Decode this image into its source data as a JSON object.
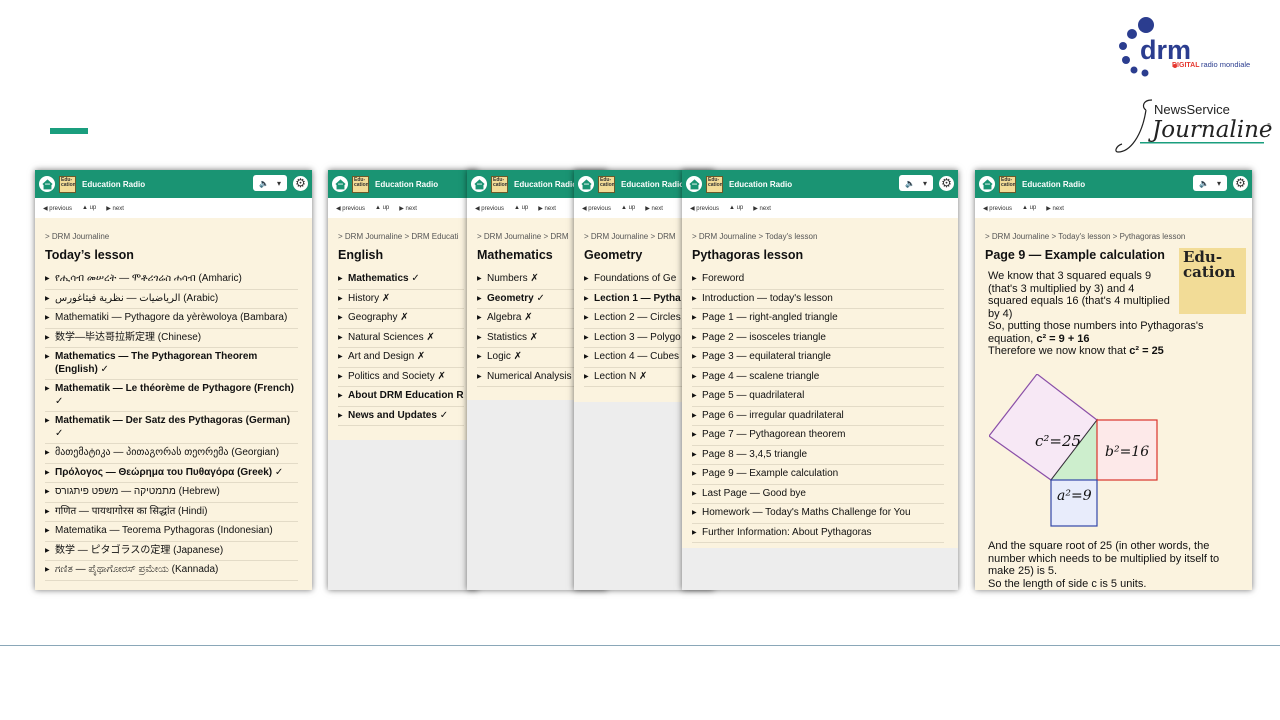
{
  "branding": {
    "drm_logo_text": "drm",
    "drm_sub_digital": "DIGITAL",
    "drm_sub_rest": "radio mondiale",
    "jl_news": "NewsService",
    "jl_name": "Journaline",
    "jl_mark": "®"
  },
  "colors": {
    "header_green": "#1a9473",
    "accent": "#1a9e7e",
    "background": "#fbf3df"
  },
  "app": {
    "title": "Education Radio",
    "nav_prev": "previous",
    "nav_up": "up",
    "nav_next": "next",
    "thumb_text": "Edu-cation"
  },
  "panels": [
    {
      "id": "p1",
      "crumb": "> DRM Journaline",
      "title": "Today’s lesson",
      "items": [
        {
          "t": "የሒሳብ መሠረት — ሞቶሪጎሬስ ሐሳብ (Amharic)",
          "b": false
        },
        {
          "t": "الرياضيات — نظرية فيثاغورس (Arabic)",
          "b": false
        },
        {
          "t": "Mathematiki — Pythagore da yèrèwoloya (Bambara)",
          "b": false
        },
        {
          "t": "数学—毕达哥拉斯定理 (Chinese)",
          "b": false
        },
        {
          "t": "Mathematics — The Pythagorean Theorem (English) ✓",
          "b": true
        },
        {
          "t": "Mathematik — Le théorème de Pythagore (French) ✓",
          "b": true
        },
        {
          "t": "Mathematik — Der Satz des Pythagoras (German) ✓",
          "b": true
        },
        {
          "t": "მათემატიკა — პითაგორას თეორემა (Georgian)",
          "b": false
        },
        {
          "t": "Πρόλογος — Θεώρημα του Πυθαγόρα (Greek) ✓",
          "b": true
        },
        {
          "t": "מתמטיקה — משפט פיתגורס (Hebrew)",
          "b": false
        },
        {
          "t": "गणित — पायथागोरस का सिद्धांत (Hindi)",
          "b": false
        },
        {
          "t": "Matematika — Teorema Pythagoras (Indonesian)",
          "b": false
        },
        {
          "t": "数学 — ピタゴラスの定理 (Japanese)",
          "b": false
        },
        {
          "t": "ಗಣಿತ — ಪೈಥಾಗೋರಸ್ ಪ್ರಮೇಯ (Kannada)",
          "b": false
        }
      ]
    },
    {
      "id": "p2",
      "crumb": "> DRM Journaline  > DRM Educati",
      "title": "English",
      "items": [
        {
          "t": "Mathematics ✓",
          "b": true
        },
        {
          "t": "History ✗",
          "b": false
        },
        {
          "t": "Geography ✗",
          "b": false
        },
        {
          "t": "Natural Sciences ✗",
          "b": false
        },
        {
          "t": "Art and Design ✗",
          "b": false
        },
        {
          "t": "Politics and Society ✗",
          "b": false
        },
        {
          "t": "About DRM Education R",
          "b": true
        },
        {
          "t": "News and Updates ✓",
          "b": true
        }
      ]
    },
    {
      "id": "p3",
      "crumb": "> DRM Journaline  > DRM",
      "title": "Mathematics",
      "items": [
        {
          "t": "Numbers ✗",
          "b": false
        },
        {
          "t": "Geometry ✓",
          "b": true
        },
        {
          "t": "Algebra ✗",
          "b": false
        },
        {
          "t": "Statistics ✗",
          "b": false
        },
        {
          "t": "Logic ✗",
          "b": false
        },
        {
          "t": "Numerical Analysis",
          "b": false
        }
      ]
    },
    {
      "id": "p4",
      "crumb": "> DRM Journaline  > DRM",
      "title": "Geometry",
      "items": [
        {
          "t": "Foundations of Ge",
          "b": false
        },
        {
          "t": "Lection 1 — Pytha",
          "b": true
        },
        {
          "t": "Lection 2 — Circles",
          "b": false
        },
        {
          "t": "Lection 3 — Polygo",
          "b": false
        },
        {
          "t": "Lection 4 — Cubes",
          "b": false
        },
        {
          "t": "Lection N ✗",
          "b": false
        }
      ]
    },
    {
      "id": "p5",
      "crumb": "> DRM Journaline  > Today's lesson",
      "title": "Pythagoras lesson",
      "items": [
        {
          "t": "Foreword",
          "b": false
        },
        {
          "t": "Introduction — today's lesson",
          "b": false
        },
        {
          "t": "Page 1 — right-angled triangle",
          "b": false
        },
        {
          "t": "Page 2 — isosceles triangle",
          "b": false
        },
        {
          "t": "Page 3 — equilateral triangle",
          "b": false
        },
        {
          "t": "Page 4 — scalene triangle",
          "b": false
        },
        {
          "t": "Page 5 — quadrilateral",
          "b": false
        },
        {
          "t": "Page 6 — irregular quadrilateral",
          "b": false
        },
        {
          "t": "Page 7 — Pythagorean theorem",
          "b": false
        },
        {
          "t": "Page 8 — 3,4,5 triangle",
          "b": false
        },
        {
          "t": "Page 9 — Example calculation",
          "b": false
        },
        {
          "t": "Last Page — Good bye",
          "b": false
        },
        {
          "t": "Homework — Today's Maths Challenge for You",
          "b": false
        },
        {
          "t": "Further Information: About Pythagoras",
          "b": false
        }
      ]
    }
  ],
  "page9": {
    "crumb": "> DRM Journaline  > Today's lesson  > Pythagoras lesson",
    "title": "Page 9 — Example calculation",
    "para1": "We know that 3 squared equals 9 (that's 3 multiplied by 3) and 4 squared equals 16 (that's 4 multiplied by 4)",
    "para2a": "So, putting those numbers into Pythagoras's equation, ",
    "para2b": "c² = 9 + 16",
    "para3a": "Therefore we now know that ",
    "para3b": "c² = 25",
    "para4": "And the square root of 25 (in other words, the number which needs to be multiplied by itself to make 25) is 5.",
    "para5": "So the length of side c is 5 units.",
    "edu_text": "Edu-cation",
    "label_c": "c²=25",
    "label_b": "b²=16",
    "label_a": "a²=9"
  }
}
